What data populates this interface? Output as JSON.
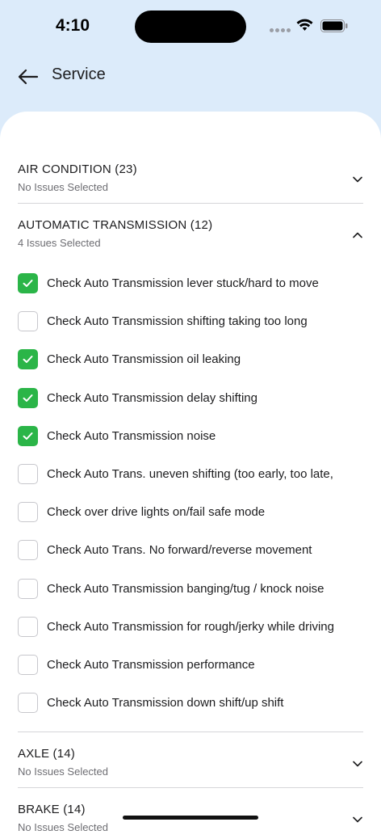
{
  "status": {
    "time": "4:10"
  },
  "header": {
    "title": "Service"
  },
  "sections": {
    "air_condition": {
      "title": "AIR CONDITION (23)",
      "subtitle": "No Issues Selected"
    },
    "automatic_transmission": {
      "title": "AUTOMATIC TRANSMISSION (12)",
      "subtitle": "4 Issues Selected"
    },
    "axle": {
      "title": "AXLE (14)",
      "subtitle": "No Issues Selected"
    },
    "brake": {
      "title": "BRAKE (14)",
      "subtitle": "No Issues Selected"
    }
  },
  "issues": [
    {
      "label": "Check Auto Transmission lever stuck/hard to move",
      "checked": true
    },
    {
      "label": "Check Auto Transmission shifting taking too long",
      "checked": false
    },
    {
      "label": "Check Auto Transmission oil leaking",
      "checked": true
    },
    {
      "label": "Check Auto Transmission delay shifting",
      "checked": true
    },
    {
      "label": "Check Auto Transmission noise",
      "checked": true
    },
    {
      "label": "Check Auto Trans. uneven shifting (too early, too late,",
      "checked": false
    },
    {
      "label": "Check over drive lights on/fail safe mode",
      "checked": false
    },
    {
      "label": "Check Auto Trans. No forward/reverse movement",
      "checked": false
    },
    {
      "label": "Check Auto Transmission banging/tug / knock noise",
      "checked": false
    },
    {
      "label": "Check Auto Transmission for rough/jerky while driving",
      "checked": false
    },
    {
      "label": "Check Auto Transmission performance",
      "checked": false
    },
    {
      "label": "Check Auto Transmission down shift/up shift",
      "checked": false
    }
  ],
  "colors": {
    "accent_green": "#2bb548",
    "header_bg": "#dcebfa"
  }
}
